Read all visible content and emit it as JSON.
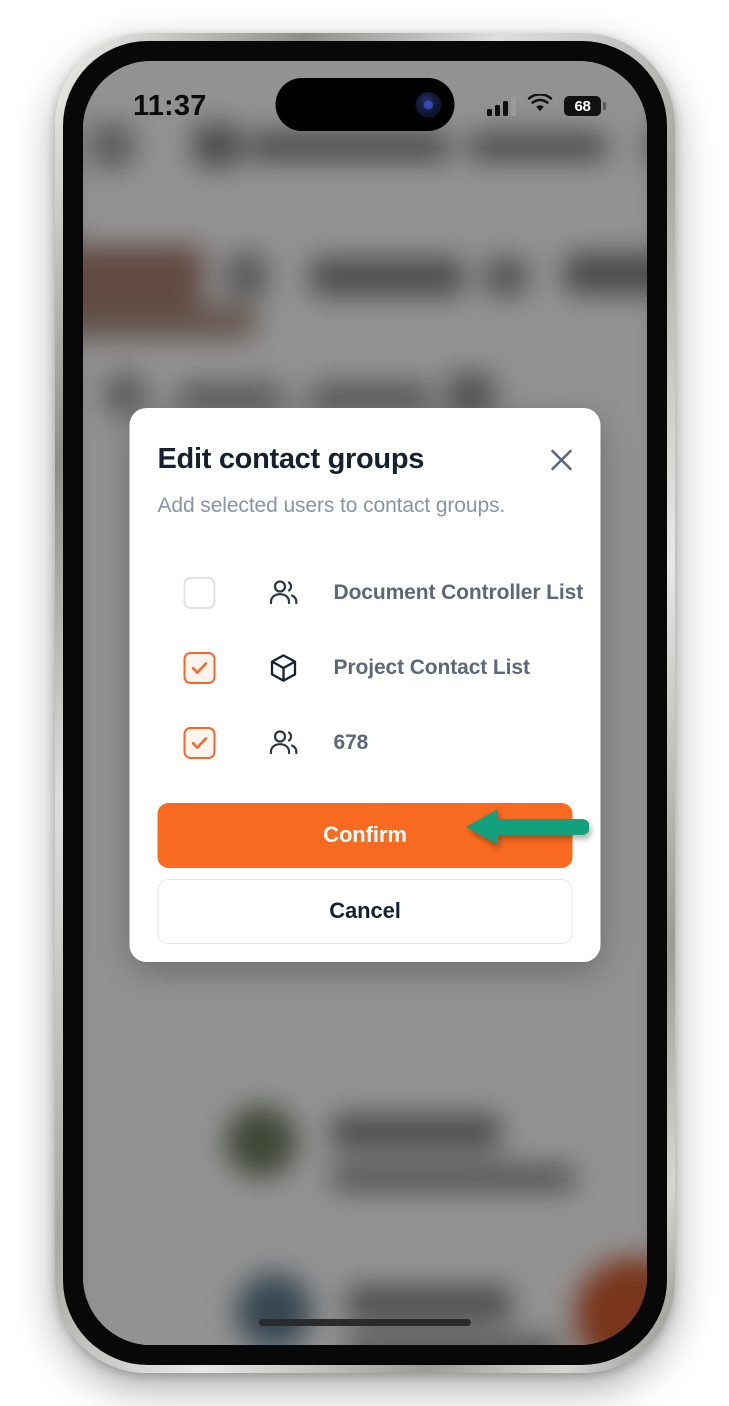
{
  "status_bar": {
    "time": "11:37",
    "cellular_icon": "cellular-signal-icon",
    "wifi_icon": "wifi-icon",
    "battery_level": "68"
  },
  "modal": {
    "title": "Edit contact groups",
    "subtitle": "Add selected users to contact groups.",
    "close_icon": "close-icon",
    "groups": [
      {
        "label": "Document Controller List",
        "checked": false,
        "icon": "users-group-icon"
      },
      {
        "label": "Project Contact List",
        "checked": true,
        "icon": "cube-icon"
      },
      {
        "label": "678",
        "checked": true,
        "icon": "users-group-icon"
      }
    ],
    "confirm_label": "Confirm",
    "cancel_label": "Cancel"
  },
  "annotation": {
    "arrow_icon": "left-pointing-arrow",
    "arrow_color": "#13a07c",
    "points_at": "678"
  },
  "colors": {
    "accent_orange": "#f96a21",
    "checkbox_checked_border": "#f4692a",
    "checkbox_checked_fill": "#fef4ee",
    "checkbox_unchecked_border": "#dfe3e9",
    "title_text": "#16202e",
    "subtitle_text": "#8a94a6",
    "label_text": "#5d6779",
    "icon_dark": "#2c3547",
    "modal_background": "#ffffff",
    "scrim": "rgba(30,30,30,0.46)"
  }
}
